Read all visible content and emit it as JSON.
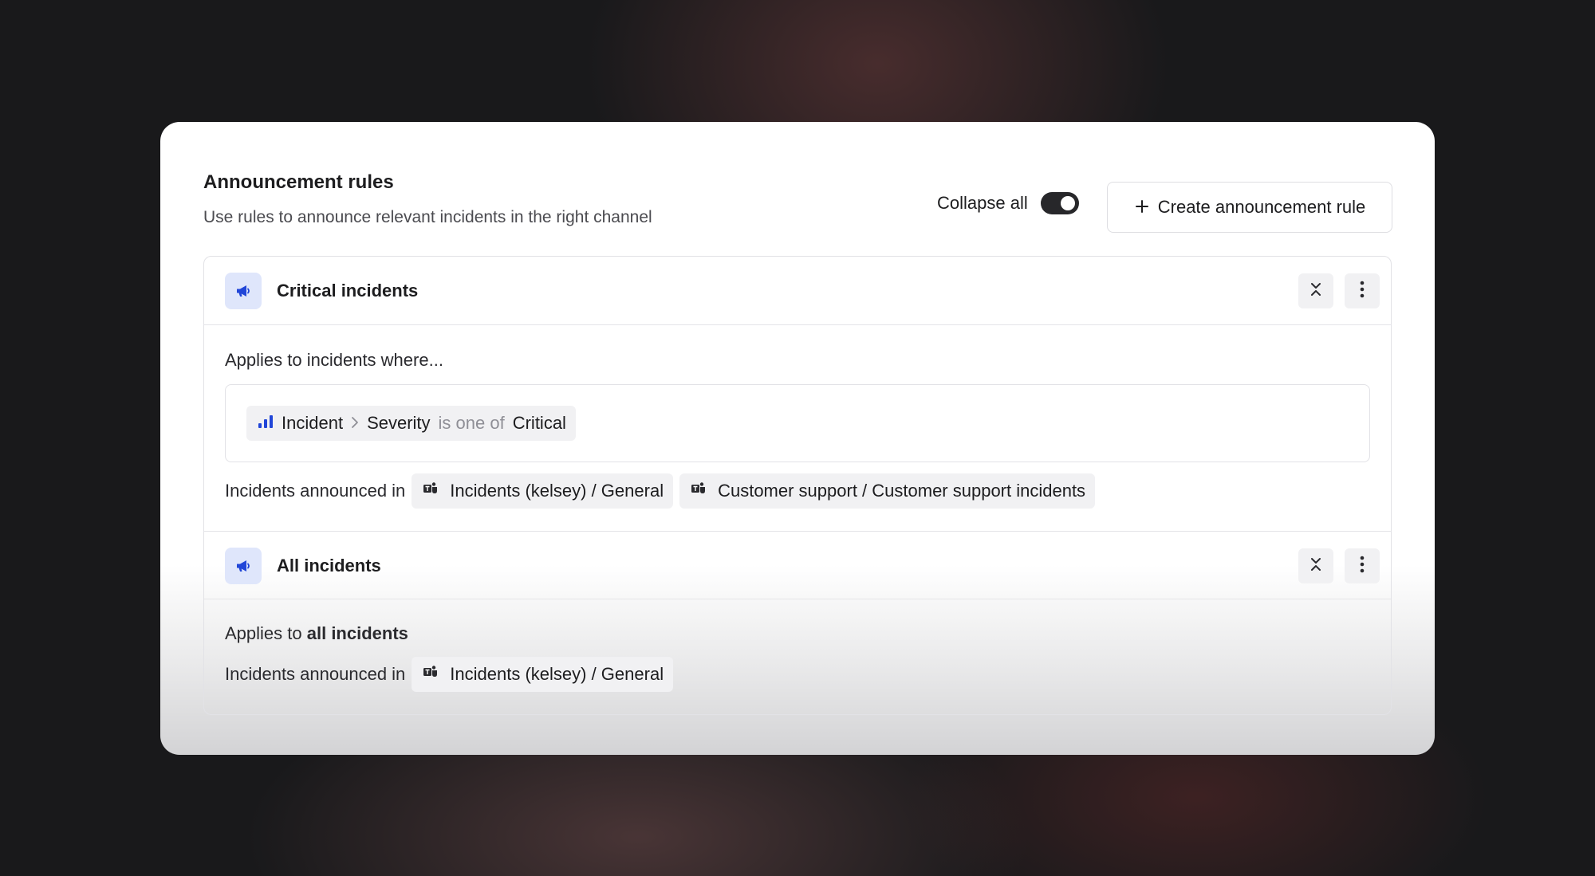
{
  "header": {
    "title": "Announcement rules",
    "subtitle": "Use rules to announce relevant incidents in the right channel",
    "collapse_label": "Collapse all",
    "collapse_on": true,
    "create_label": "Create announcement rule"
  },
  "rules": [
    {
      "name": "Critical incidents",
      "applies_label": "Applies to incidents where...",
      "condition": {
        "entity": "Incident",
        "field": "Severity",
        "operator": "is one of",
        "value": "Critical"
      },
      "announced_label": "Incidents announced in",
      "channels": [
        "Incidents (kelsey) / General",
        "Customer support / Customer support incidents"
      ]
    },
    {
      "name": "All incidents",
      "applies_prefix": "Applies to",
      "applies_scope": "all incidents",
      "announced_label": "Incidents announced in",
      "channels": [
        "Incidents (kelsey) / General"
      ]
    }
  ],
  "icons": {
    "rule": "megaphone-icon",
    "collapse": "collapse-chevrons-icon",
    "more": "more-vertical-icon",
    "severity": "severity-bars-icon",
    "channel": "teams-icon",
    "create": "plus-icon"
  },
  "colors": {
    "accent": "#2146d8",
    "accent_bg": "#dfe6fb",
    "toggle": "#27272a"
  }
}
